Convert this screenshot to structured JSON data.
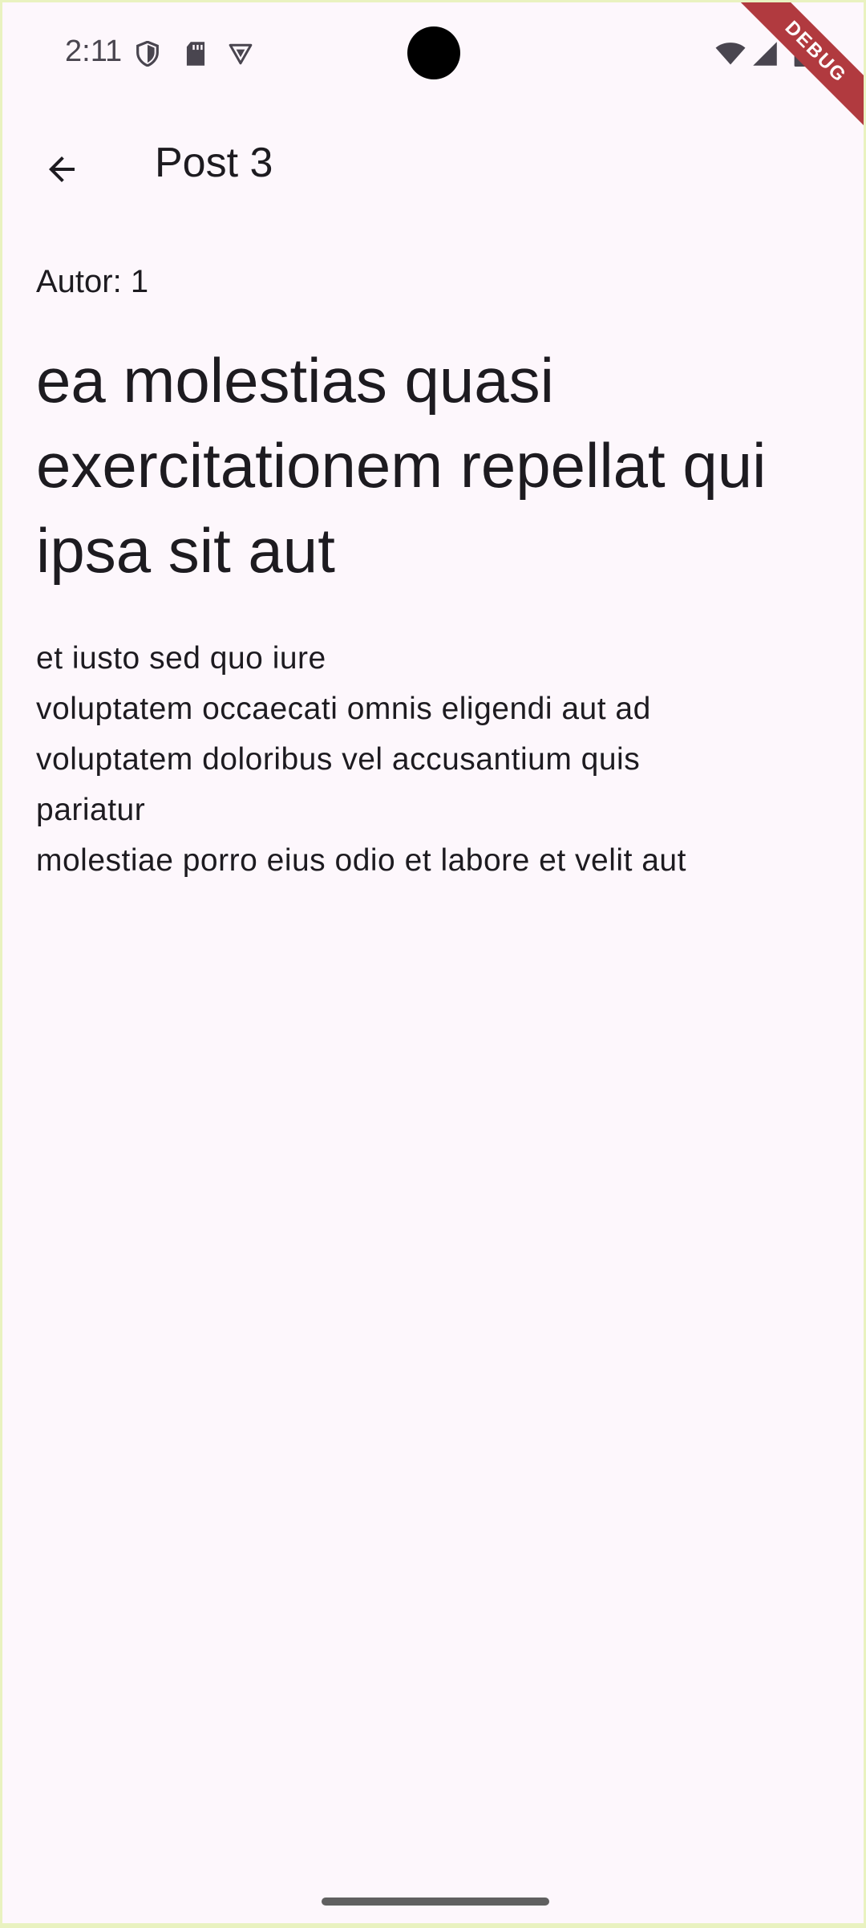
{
  "status_bar": {
    "time": "2:11",
    "icons_left": [
      "shield-icon",
      "sd-card-icon",
      "vpn-badge-icon"
    ],
    "icons_right": [
      "wifi-icon",
      "signal-icon",
      "battery-icon"
    ]
  },
  "debug_banner": {
    "label": "DEBUG",
    "color": "#b13a3f"
  },
  "app_bar": {
    "back_icon": "arrow-back-icon",
    "title": "Post 3"
  },
  "post": {
    "author": "Autor: 1",
    "title": "ea molestias quasi exercitationem repellat qui ipsa sit aut",
    "body_lines": [
      "et iusto sed quo iure",
      "voluptatem occaecati omnis eligendi aut ad",
      "voluptatem doloribus vel accusantium quis pariatur",
      "molestiae porro eius odio et labore et velit aut"
    ]
  },
  "colors": {
    "background": "#fdf7fc",
    "text": "#1d1b20",
    "frame": "#c6e06b"
  }
}
